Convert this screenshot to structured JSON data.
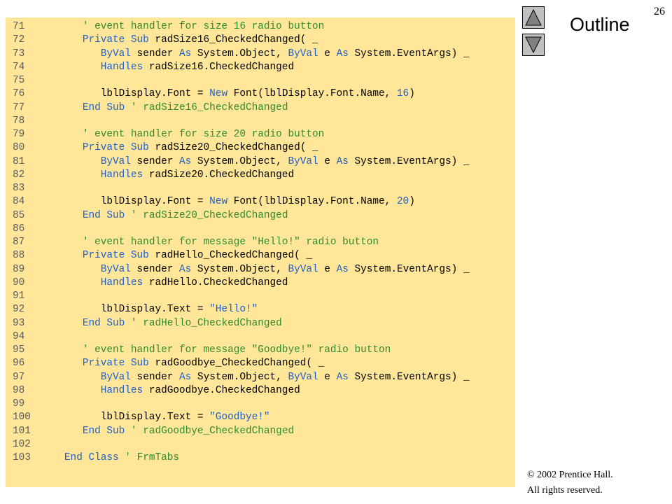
{
  "slide": {
    "number": "26",
    "outline_label": "Outline",
    "copyright_line1": "© 2002 Prentice Hall.",
    "copyright_line2": "All rights reserved."
  },
  "nav": {
    "up_icon": "triangle-up-icon",
    "down_icon": "triangle-down-icon"
  },
  "colors": {
    "panel_bg": "#FFE699",
    "keyword": "#1F5FCC",
    "comment": "#2E8B2E",
    "plain": "#000000",
    "nav_button": "#C0C0C0"
  },
  "code": [
    {
      "n": "71",
      "tokens": [
        {
          "t": "      ",
          "k": "pl"
        },
        {
          "t": "' event handler for size 16 radio button",
          "k": "cm"
        }
      ]
    },
    {
      "n": "72",
      "tokens": [
        {
          "t": "      ",
          "k": "pl"
        },
        {
          "t": "Private Sub",
          "k": "kw"
        },
        {
          "t": " radSize16_CheckedChanged( _",
          "k": "pl"
        }
      ]
    },
    {
      "n": "73",
      "tokens": [
        {
          "t": "         ",
          "k": "pl"
        },
        {
          "t": "ByVal",
          "k": "kw"
        },
        {
          "t": " sender ",
          "k": "pl"
        },
        {
          "t": "As",
          "k": "kw"
        },
        {
          "t": " System.Object, ",
          "k": "pl"
        },
        {
          "t": "ByVal",
          "k": "kw"
        },
        {
          "t": " e ",
          "k": "pl"
        },
        {
          "t": "As",
          "k": "kw"
        },
        {
          "t": " System.EventArgs) _",
          "k": "pl"
        }
      ]
    },
    {
      "n": "74",
      "tokens": [
        {
          "t": "         ",
          "k": "pl"
        },
        {
          "t": "Handles",
          "k": "kw"
        },
        {
          "t": " radSize16.CheckedChanged",
          "k": "pl"
        }
      ]
    },
    {
      "n": "75",
      "tokens": []
    },
    {
      "n": "76",
      "tokens": [
        {
          "t": "         lblDisplay.Font = ",
          "k": "pl"
        },
        {
          "t": "New",
          "k": "kw"
        },
        {
          "t": " Font(lblDisplay.Font.Name, ",
          "k": "pl"
        },
        {
          "t": "16",
          "k": "nm"
        },
        {
          "t": ")",
          "k": "pl"
        }
      ]
    },
    {
      "n": "77",
      "tokens": [
        {
          "t": "      ",
          "k": "pl"
        },
        {
          "t": "End Sub",
          "k": "kw"
        },
        {
          "t": " ",
          "k": "pl"
        },
        {
          "t": "' radSize16_CheckedChanged",
          "k": "cm"
        }
      ]
    },
    {
      "n": "78",
      "tokens": []
    },
    {
      "n": "79",
      "tokens": [
        {
          "t": "      ",
          "k": "pl"
        },
        {
          "t": "' event handler for size 20 radio button",
          "k": "cm"
        }
      ]
    },
    {
      "n": "80",
      "tokens": [
        {
          "t": "      ",
          "k": "pl"
        },
        {
          "t": "Private Sub",
          "k": "kw"
        },
        {
          "t": " radSize20_CheckedChanged( _",
          "k": "pl"
        }
      ]
    },
    {
      "n": "81",
      "tokens": [
        {
          "t": "         ",
          "k": "pl"
        },
        {
          "t": "ByVal",
          "k": "kw"
        },
        {
          "t": " sender ",
          "k": "pl"
        },
        {
          "t": "As",
          "k": "kw"
        },
        {
          "t": " System.Object, ",
          "k": "pl"
        },
        {
          "t": "ByVal",
          "k": "kw"
        },
        {
          "t": " e ",
          "k": "pl"
        },
        {
          "t": "As",
          "k": "kw"
        },
        {
          "t": " System.EventArgs) _",
          "k": "pl"
        }
      ]
    },
    {
      "n": "82",
      "tokens": [
        {
          "t": "         ",
          "k": "pl"
        },
        {
          "t": "Handles",
          "k": "kw"
        },
        {
          "t": " radSize20.CheckedChanged",
          "k": "pl"
        }
      ]
    },
    {
      "n": "83",
      "tokens": []
    },
    {
      "n": "84",
      "tokens": [
        {
          "t": "         lblDisplay.Font = ",
          "k": "pl"
        },
        {
          "t": "New",
          "k": "kw"
        },
        {
          "t": " Font(lblDisplay.Font.Name, ",
          "k": "pl"
        },
        {
          "t": "20",
          "k": "nm"
        },
        {
          "t": ")",
          "k": "pl"
        }
      ]
    },
    {
      "n": "85",
      "tokens": [
        {
          "t": "      ",
          "k": "pl"
        },
        {
          "t": "End Sub",
          "k": "kw"
        },
        {
          "t": " ",
          "k": "pl"
        },
        {
          "t": "' radSize20_CheckedChanged",
          "k": "cm"
        }
      ]
    },
    {
      "n": "86",
      "tokens": []
    },
    {
      "n": "87",
      "tokens": [
        {
          "t": "      ",
          "k": "pl"
        },
        {
          "t": "' event handler for message \"Hello!\" radio button",
          "k": "cm"
        }
      ]
    },
    {
      "n": "88",
      "tokens": [
        {
          "t": "      ",
          "k": "pl"
        },
        {
          "t": "Private Sub",
          "k": "kw"
        },
        {
          "t": " radHello_CheckedChanged( _",
          "k": "pl"
        }
      ]
    },
    {
      "n": "89",
      "tokens": [
        {
          "t": "         ",
          "k": "pl"
        },
        {
          "t": "ByVal",
          "k": "kw"
        },
        {
          "t": " sender ",
          "k": "pl"
        },
        {
          "t": "As",
          "k": "kw"
        },
        {
          "t": " System.Object, ",
          "k": "pl"
        },
        {
          "t": "ByVal",
          "k": "kw"
        },
        {
          "t": " e ",
          "k": "pl"
        },
        {
          "t": "As",
          "k": "kw"
        },
        {
          "t": " System.EventArgs) _",
          "k": "pl"
        }
      ]
    },
    {
      "n": "90",
      "tokens": [
        {
          "t": "         ",
          "k": "pl"
        },
        {
          "t": "Handles",
          "k": "kw"
        },
        {
          "t": " radHello.CheckedChanged",
          "k": "pl"
        }
      ]
    },
    {
      "n": "91",
      "tokens": []
    },
    {
      "n": "92",
      "tokens": [
        {
          "t": "         lblDisplay.Text = ",
          "k": "pl"
        },
        {
          "t": "\"Hello!\"",
          "k": "st"
        }
      ]
    },
    {
      "n": "93",
      "tokens": [
        {
          "t": "      ",
          "k": "pl"
        },
        {
          "t": "End Sub",
          "k": "kw"
        },
        {
          "t": " ",
          "k": "pl"
        },
        {
          "t": "' radHello_CheckedChanged",
          "k": "cm"
        }
      ]
    },
    {
      "n": "94",
      "tokens": []
    },
    {
      "n": "95",
      "tokens": [
        {
          "t": "      ",
          "k": "pl"
        },
        {
          "t": "' event handler for message \"Goodbye!\" radio button",
          "k": "cm"
        }
      ]
    },
    {
      "n": "96",
      "tokens": [
        {
          "t": "      ",
          "k": "pl"
        },
        {
          "t": "Private Sub",
          "k": "kw"
        },
        {
          "t": " radGoodbye_CheckedChanged( _",
          "k": "pl"
        }
      ]
    },
    {
      "n": "97",
      "tokens": [
        {
          "t": "         ",
          "k": "pl"
        },
        {
          "t": "ByVal",
          "k": "kw"
        },
        {
          "t": " sender ",
          "k": "pl"
        },
        {
          "t": "As",
          "k": "kw"
        },
        {
          "t": " System.Object, ",
          "k": "pl"
        },
        {
          "t": "ByVal",
          "k": "kw"
        },
        {
          "t": " e ",
          "k": "pl"
        },
        {
          "t": "As",
          "k": "kw"
        },
        {
          "t": " System.EventArgs) _",
          "k": "pl"
        }
      ]
    },
    {
      "n": "98",
      "tokens": [
        {
          "t": "         ",
          "k": "pl"
        },
        {
          "t": "Handles",
          "k": "kw"
        },
        {
          "t": " radGoodbye.CheckedChanged",
          "k": "pl"
        }
      ]
    },
    {
      "n": "99",
      "tokens": []
    },
    {
      "n": "100",
      "tokens": [
        {
          "t": "         lblDisplay.Text = ",
          "k": "pl"
        },
        {
          "t": "\"Goodbye!\"",
          "k": "st"
        }
      ]
    },
    {
      "n": "101",
      "tokens": [
        {
          "t": "      ",
          "k": "pl"
        },
        {
          "t": "End Sub",
          "k": "kw"
        },
        {
          "t": " ",
          "k": "pl"
        },
        {
          "t": "' radGoodbye_CheckedChanged",
          "k": "cm"
        }
      ]
    },
    {
      "n": "102",
      "tokens": []
    },
    {
      "n": "103",
      "tokens": [
        {
          "t": "   ",
          "k": "pl"
        },
        {
          "t": "End Class",
          "k": "kw"
        },
        {
          "t": " ",
          "k": "pl"
        },
        {
          "t": "' FrmTabs",
          "k": "cm"
        }
      ]
    }
  ]
}
